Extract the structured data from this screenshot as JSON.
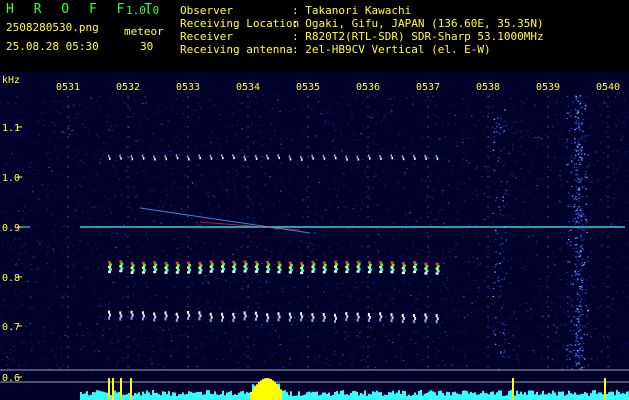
{
  "header": {
    "app_title": "H R O F F T",
    "version": "1.0.0",
    "filename": "2508280530.png",
    "datetime": "25.08.28 05:30",
    "count_label": "meteor",
    "count_value": "30",
    "rows": [
      {
        "label": "Observer",
        "value": ": Takanori Kawachi"
      },
      {
        "label": "Receiving Location",
        "value": ": Ogaki, Gifu, JAPAN (136.60E, 35.35N)"
      },
      {
        "label": "Receiver",
        "value": ": R820T2(RTL-SDR) SDR-Sharp 53.1000MHz"
      },
      {
        "label": "Receiving antenna",
        "value": ": 2el-HB9CV Vertical (el. E-W)"
      }
    ]
  },
  "spectrogram": {
    "freq_unit": "kHz",
    "time_labels": [
      "0531",
      "0532",
      "0533",
      "0534",
      "0535",
      "0536",
      "0537",
      "0538",
      "0539",
      "0540"
    ],
    "freq_labels": [
      "1.1",
      "1.0",
      "0.9",
      "0.8",
      "0.7",
      "0.6"
    ],
    "colors": {
      "background": "#00002a",
      "text_green": "#33ff33",
      "text_yellow": "#ffff33",
      "text_cyan": "#33ffff",
      "carrier": "#33ffff",
      "level": "#33ffff",
      "level_peak": "#ffff00"
    }
  }
}
